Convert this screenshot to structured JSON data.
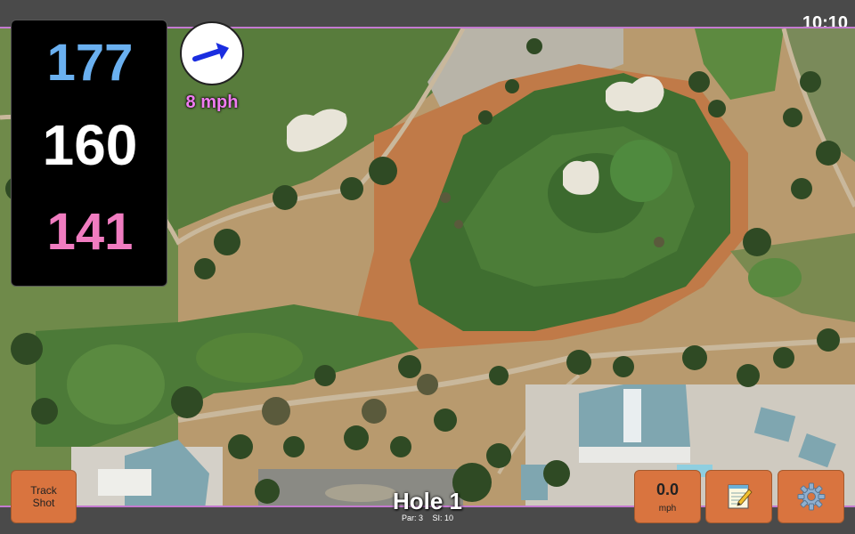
{
  "clock": "10:10",
  "distances": {
    "back": "177",
    "middle": "160",
    "front": "141",
    "colors": {
      "back": "#6ab0f0",
      "middle": "#ffffff",
      "front": "#f07cc0"
    }
  },
  "wind": {
    "speed_label": "8 mph",
    "direction_icon": "arrow-east-northeast-icon",
    "arrow_color": "#1a2de0",
    "label_color": "#f07cf0"
  },
  "buttons": {
    "track_shot": {
      "line1": "Track",
      "line2": "Shot"
    },
    "speed": {
      "value": "0.0",
      "unit": "mph"
    },
    "notes_icon": "notepad-icon",
    "settings_icon": "gear-icon",
    "color": "#d9743f"
  },
  "hole": {
    "title": "Hole 1",
    "par": "Par: 3",
    "si": "SI: 10"
  }
}
